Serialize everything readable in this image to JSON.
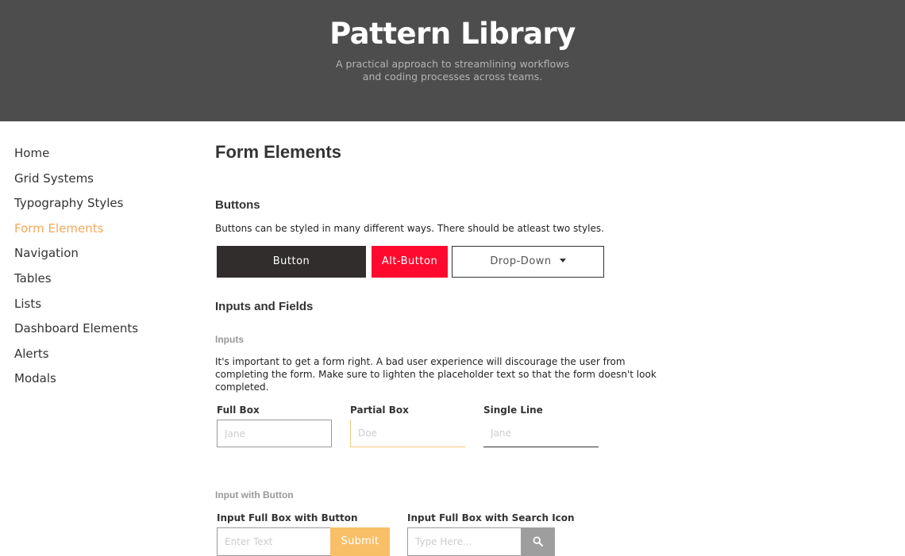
{
  "header": {
    "title": "Pattern Library",
    "subtitle_line1": "A practical approach to streamlining workflows",
    "subtitle_line2": "and coding processes across teams."
  },
  "sidebar": {
    "items": [
      {
        "label": "Home",
        "active": false
      },
      {
        "label": "Grid Systems",
        "active": false
      },
      {
        "label": "Typography Styles",
        "active": false
      },
      {
        "label": "Form Elements",
        "active": true
      },
      {
        "label": "Navigation",
        "active": false
      },
      {
        "label": "Tables",
        "active": false
      },
      {
        "label": "Lists",
        "active": false
      },
      {
        "label": "Dashboard Elements",
        "active": false
      },
      {
        "label": "Alerts",
        "active": false
      },
      {
        "label": "Modals",
        "active": false
      }
    ]
  },
  "main": {
    "page_title": "Form Elements",
    "buttons": {
      "title": "Buttons",
      "description": "Buttons can be styled in many different ways. There should be atleast two styles.",
      "primary_label": "Button",
      "alt_label": "Alt-Button",
      "dropdown_label": "Drop-Down"
    },
    "inputs_fields": {
      "title": "Inputs and Fields",
      "inputs_subtitle": "Inputs",
      "inputs_desc_line1": "It's important to get a form right. A bad user experience will discourage the user from",
      "inputs_desc_line2": "completing the form. Make sure to lighten the placeholder text so that the form doesn't look",
      "inputs_desc_line3": "completed.",
      "full_box": {
        "label": "Full Box",
        "placeholder": "Jane",
        "value": ""
      },
      "partial_box": {
        "label": "Partial Box",
        "placeholder": "Doe",
        "value": ""
      },
      "single_line": {
        "label": "Single Line",
        "placeholder": "Jane",
        "value": ""
      },
      "input_with_button_subtitle": "Input with Button",
      "input_button": {
        "label": "Input Full Box with Button",
        "placeholder": "Enter Text",
        "value": "",
        "button_label": "Submit"
      },
      "input_search": {
        "label": "Input Full Box with Search Icon",
        "placeholder": "Type Here...",
        "value": "",
        "icon": "search-icon"
      }
    }
  },
  "colors": {
    "header_bg": "#4d4d4d",
    "accent": "#f5a85b",
    "primary_button": "#312d2d",
    "alt_button": "#ff0a2f",
    "submit_button": "#f8bf67",
    "search_button": "#9e9e9e"
  }
}
